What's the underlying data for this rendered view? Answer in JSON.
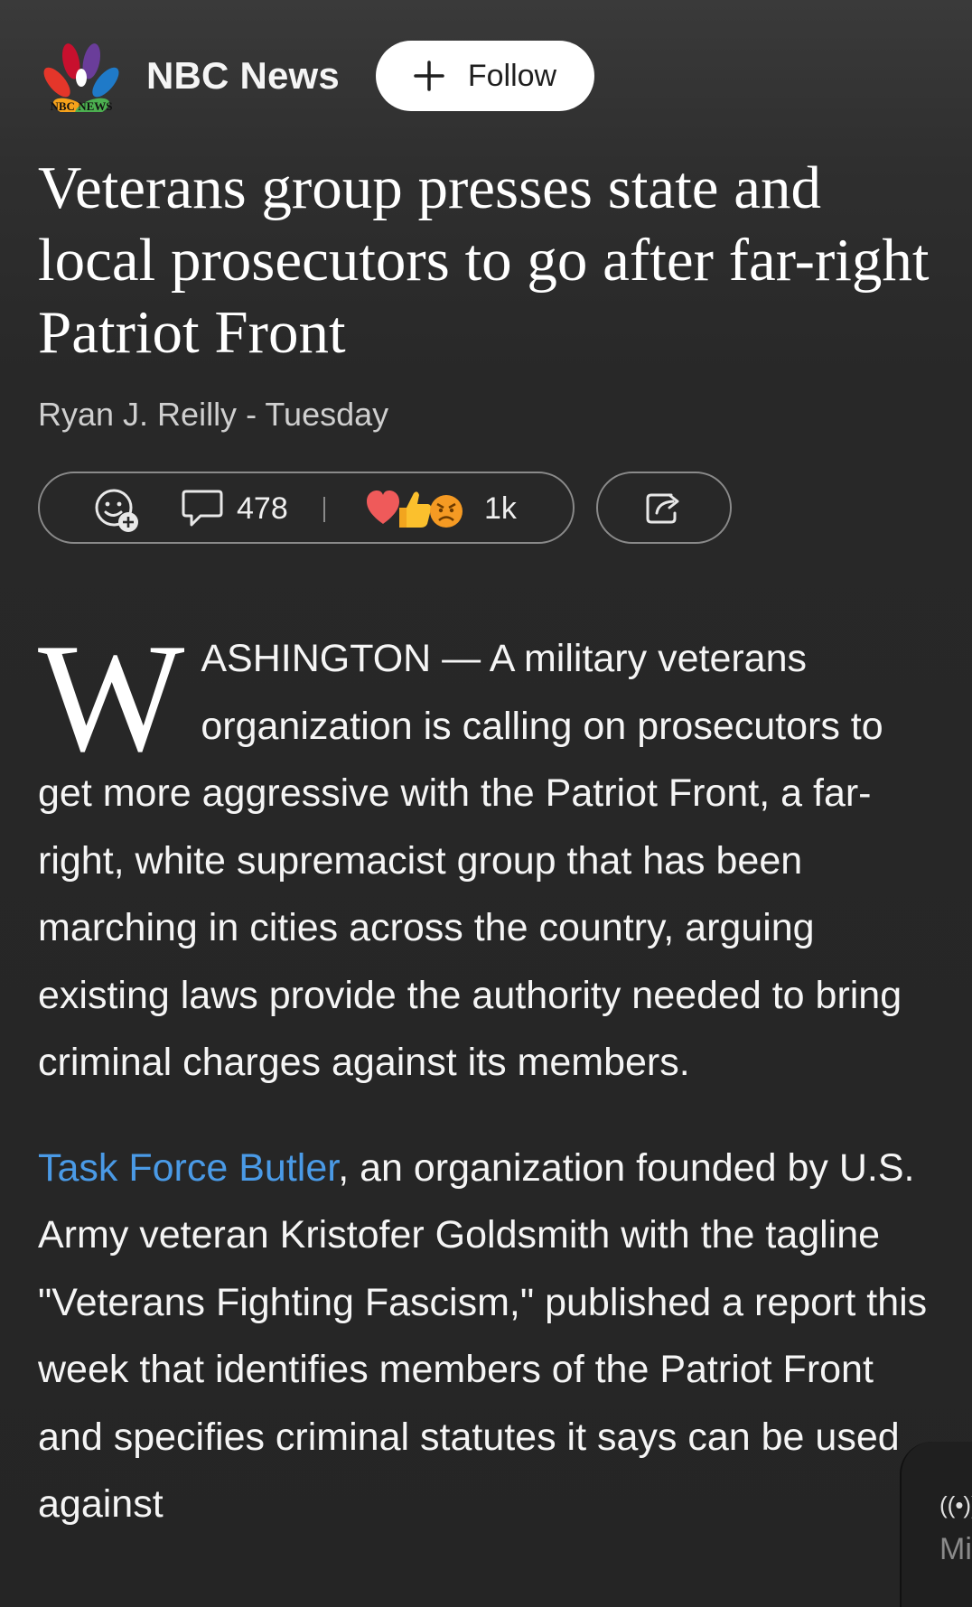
{
  "source": {
    "name": "NBC News",
    "logo_text": "NBC NEWS",
    "follow_label": "Follow"
  },
  "article": {
    "headline": "Veterans group presses state and local prosecutors to go after far-right Patriot Front",
    "byline": "Ryan J. Reilly - Tuesday",
    "dropcap": "W",
    "para1_rest": "ASHINGTON — A military veterans organization is calling on prosecutors to get more aggressive with the Patriot Front, a far-right, white supremacist group that has been marching in cities across the country, arguing existing laws provide the authority needed to bring criminal charges against its members.",
    "para2_link": "Task Force Butler",
    "para2_rest": ", an organization founded by U.S. Army veteran Kristofer Goldsmith with the tagline \"Veterans Fighting Fascism,\" published a report this week that identifies members of the Patriot Front and specifies criminal statutes it says can be used against"
  },
  "engagement": {
    "comment_count": "478",
    "reaction_count": "1k",
    "reaction_emojis": [
      "heart",
      "thumbs-up",
      "angry-face"
    ]
  },
  "mini_player": {
    "label": "Mi",
    "icon": "broadcast-icon"
  },
  "colors": {
    "link": "#4a9ae6",
    "background": "#262626",
    "follow_button_bg": "#ffffff"
  }
}
